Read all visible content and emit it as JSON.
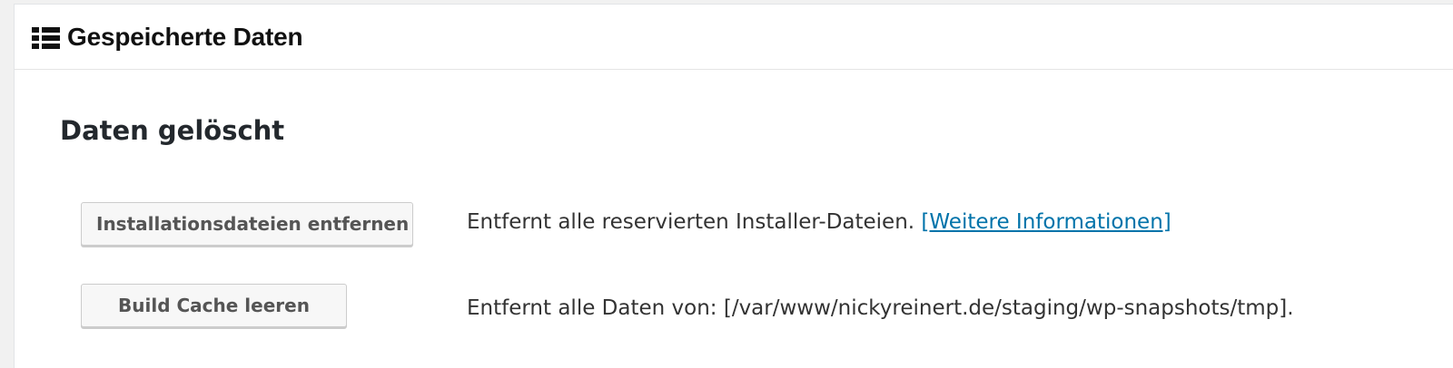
{
  "panel": {
    "title": "Gespeicherte Daten",
    "icon": "list-icon"
  },
  "section": {
    "title": "Daten gelöscht"
  },
  "actions": [
    {
      "button_label": "Installationsdateien entfernen",
      "description": "Entfernt alle reservierten Installer-Dateien.",
      "link_text": "[Weitere Informationen]"
    },
    {
      "button_label": "Build Cache leeren",
      "description": "Entfernt alle Daten von: [/var/www/nickyreinert.de/staging/wp-snapshots/tmp]."
    }
  ],
  "colors": {
    "link": "#0073aa",
    "text": "#333333",
    "button_bg": "#f7f7f7"
  }
}
